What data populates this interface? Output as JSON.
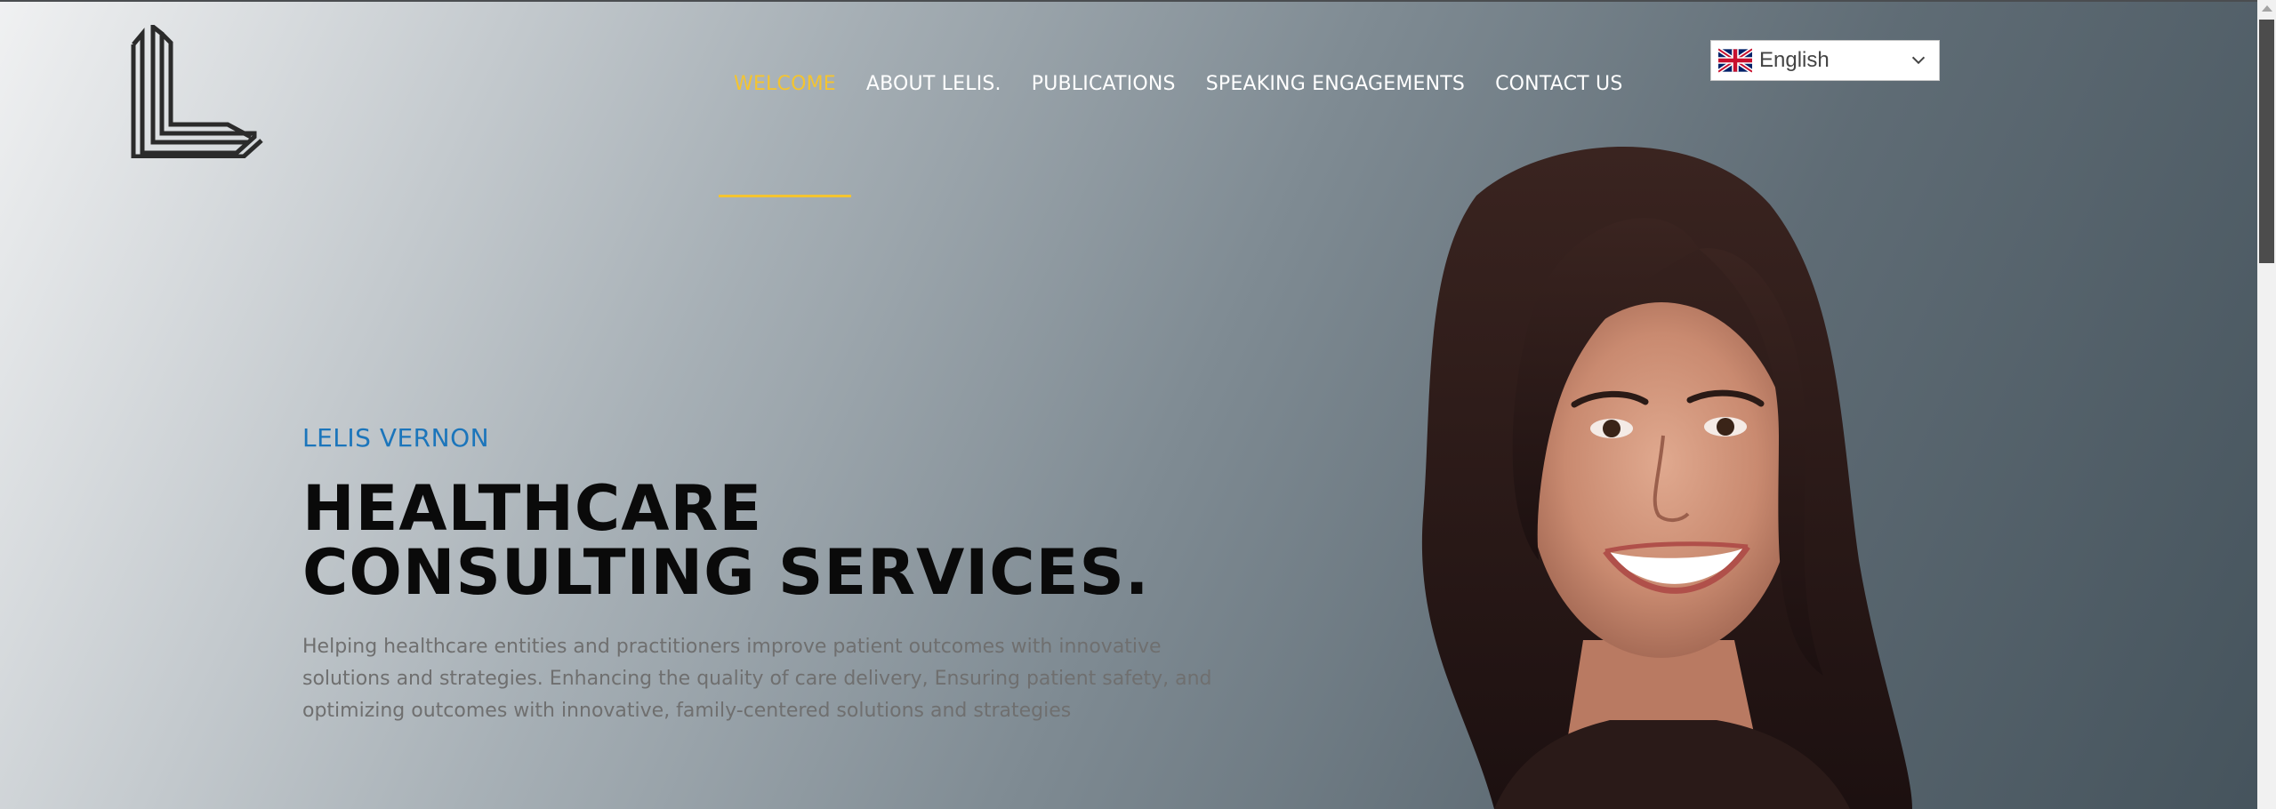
{
  "nav": {
    "items": [
      {
        "label": "WELCOME",
        "active": true
      },
      {
        "label": "ABOUT LELIS.",
        "active": false
      },
      {
        "label": "PUBLICATIONS",
        "active": false
      },
      {
        "label": "SPEAKING ENGAGEMENTS",
        "active": false
      },
      {
        "label": "CONTACT US",
        "active": false
      }
    ],
    "active_color": "#f4c430"
  },
  "language": {
    "selected": "English",
    "flag_icon": "uk-flag-icon",
    "dropdown_icon": "chevron-down-icon"
  },
  "hero": {
    "eyebrow": "LELIS VERNON",
    "headline_line1": "HEALTHCARE",
    "headline_line2": "CONSULTING SERVICES.",
    "desc_line1": "Helping healthcare entities and practitioners improve patient outcomes with innovative",
    "desc_line2": "solutions and strategies. Enhancing the quality of care delivery, Ensuring patient safety, and",
    "desc_line3": "optimizing outcomes with innovative, family-centered solutions and strategies"
  },
  "colors": {
    "eyebrow": "#1b75bb",
    "headline": "#0a0a0a",
    "nav_text": "#ffffff"
  }
}
